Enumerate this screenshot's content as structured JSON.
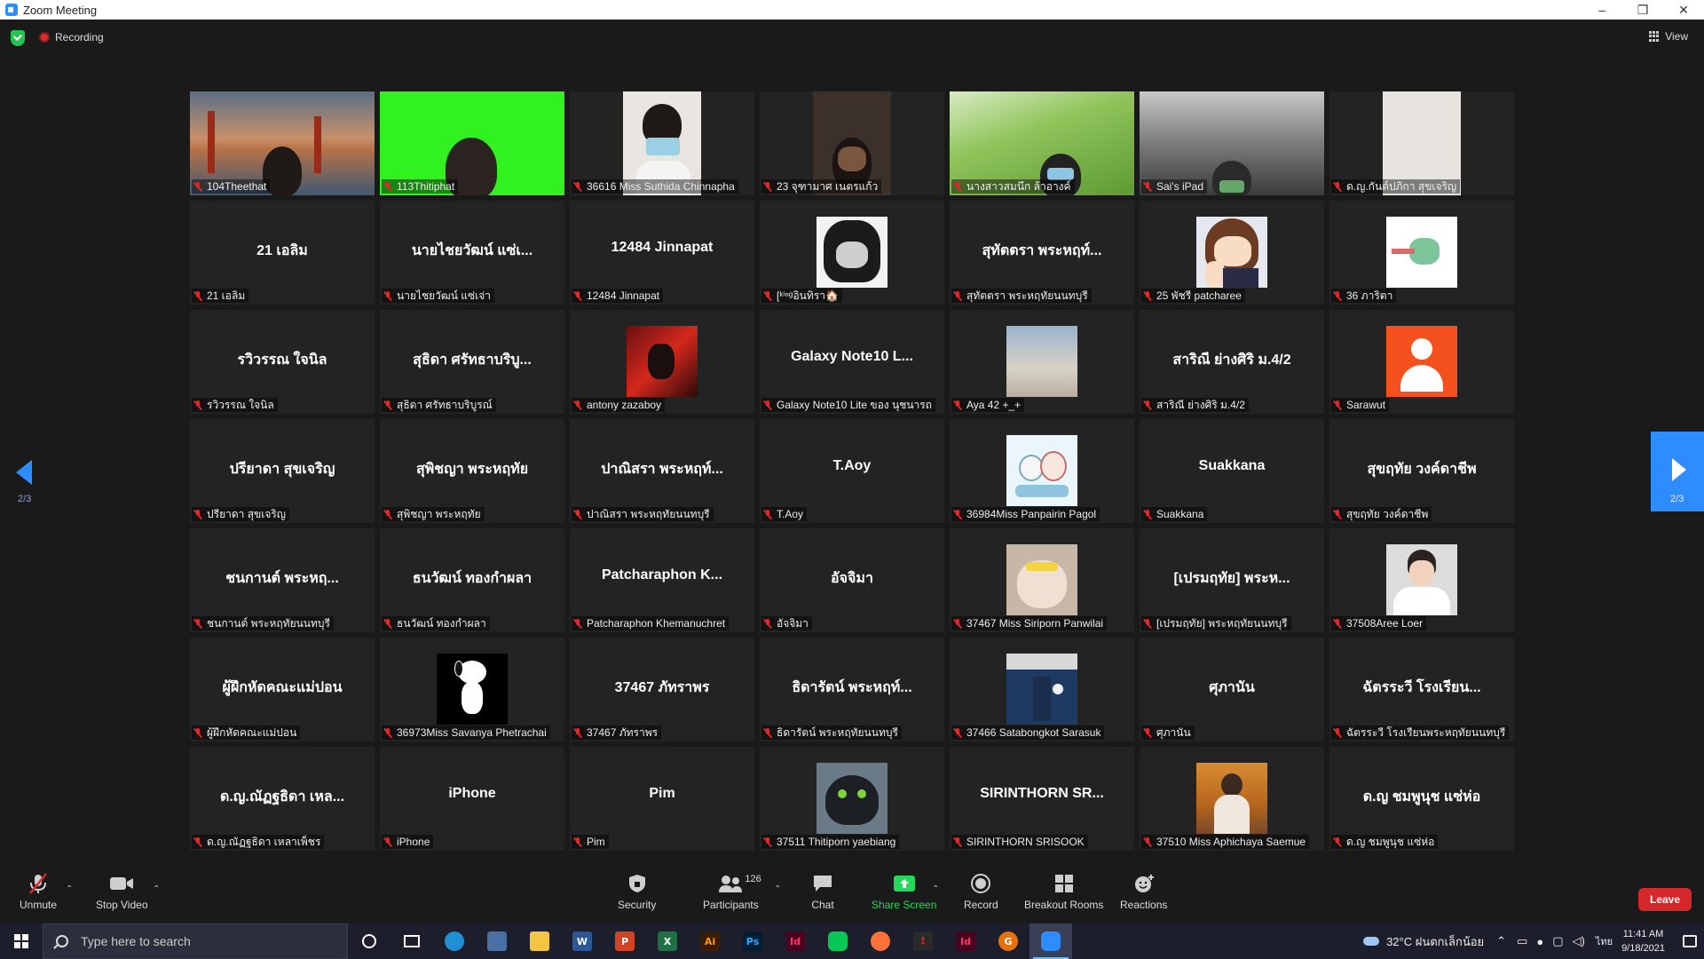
{
  "window": {
    "title": "Zoom Meeting",
    "minimize": "–",
    "maximize": "❐",
    "close": "✕"
  },
  "topbar": {
    "recording_label": "Recording",
    "view_label": "View"
  },
  "gallery": {
    "page_indicator_left": "2/3",
    "page_indicator_right": "2/3",
    "tiles": [
      {
        "caption": "104Theethat",
        "display": "",
        "visual": "bridge"
      },
      {
        "caption": "113Thitiphat",
        "display": "",
        "visual": "green"
      },
      {
        "caption": "36616 Miss Suthida Chinnapha",
        "display": "",
        "visual": "video-white"
      },
      {
        "caption": "23 จุฑามาศ เนตรแก้ว",
        "display": "",
        "visual": "video-dark"
      },
      {
        "caption": "นางสาวสมนึก ล้าอางค์",
        "display": "",
        "visual": "grass"
      },
      {
        "caption": "Sai's iPad",
        "display": "",
        "visual": "roof"
      },
      {
        "caption": "ด.ญ.กันต์ปภิกา สุขเจริญ",
        "display": "",
        "visual": "wall"
      },
      {
        "caption": "21 เอลิม",
        "display": "21 เอลิม",
        "visual": "name"
      },
      {
        "caption": "นายไชยวัฒน์ แซ่เจ่า",
        "display": "นายไชยวัฒน์ แซ่เ...",
        "visual": "name"
      },
      {
        "caption": "12484 Jinnapat",
        "display": "12484 Jinnapat",
        "visual": "name"
      },
      {
        "caption": "[ᵏⁱⁿᵍอินทิรา🏠",
        "display": "",
        "visual": "avatar-anime-dark"
      },
      {
        "caption": "สุทัตตรา พระหฤทัยนนทบุรี",
        "display": "สุทัตตรา พระหฤท์...",
        "visual": "name"
      },
      {
        "caption": "25 พัชรี patcharee",
        "display": "",
        "visual": "avatar-anime"
      },
      {
        "caption": "36 ภาริตา",
        "display": "",
        "visual": "avatar-dino"
      },
      {
        "caption": "รวิวรรณ ใจนิล",
        "display": "รวิวรรณ ใจนิล",
        "visual": "name"
      },
      {
        "caption": "สุธิดา ศรัทธาบริบูรณ์",
        "display": "สุธิดา ศรัทธาบริบู...",
        "visual": "name"
      },
      {
        "caption": "antony zazaboy",
        "display": "",
        "visual": "avatar-red"
      },
      {
        "caption": "Galaxy Note10 Lite ของ นุชนารถ",
        "display": "Galaxy Note10 L...",
        "visual": "name"
      },
      {
        "caption": "Aya 42 +_+",
        "display": "",
        "visual": "avatar-sky"
      },
      {
        "caption": "สาริณี ย่างศิริ ม.4/2",
        "display": "สาริณี ย่างศิริ ม.4/2",
        "visual": "name"
      },
      {
        "caption": "Sarawut",
        "display": "",
        "visual": "avatar-orange"
      },
      {
        "caption": "ปรียาดา สุขเจริญ",
        "display": "ปรียาดา สุขเจริญ",
        "visual": "name"
      },
      {
        "caption": "สุพิชญา พระหฤทัย",
        "display": "สุพิชญา พระหฤทัย",
        "visual": "name"
      },
      {
        "caption": "ปาณิสรา พระหฤทัยนนทบุรี",
        "display": "ปาณิสรา พระหฤท์...",
        "visual": "name"
      },
      {
        "caption": "T.Aoy",
        "display": "T.Aoy",
        "visual": "name"
      },
      {
        "caption": "36984Miss Panpairin Pagol",
        "display": "",
        "visual": "avatar-cartoon"
      },
      {
        "caption": "Suakkana",
        "display": "Suakkana",
        "visual": "name"
      },
      {
        "caption": "สุขฤทัย วงค์ดาชีพ",
        "display": "สุขฤทัย วงค์ดาชีพ",
        "visual": "name"
      },
      {
        "caption": "ชนกานต์ พระหฤทัยนนทบุรี",
        "display": "ชนกานต์ พระหฤ...",
        "visual": "name"
      },
      {
        "caption": "ธนวัฒน์ ทองกำผลา",
        "display": "ธนวัฒน์ ทองกำผลา",
        "visual": "name"
      },
      {
        "caption": "Patcharaphon Khemanuchret",
        "display": "Patcharaphon K...",
        "visual": "name"
      },
      {
        "caption": "อัจจิมา",
        "display": "อัจจิมา",
        "visual": "name"
      },
      {
        "caption": "37467 Miss Siriporn Panwilai",
        "display": "",
        "visual": "avatar-cat"
      },
      {
        "caption": "[เปรมฤทัย] พระหฤทัยนนทบุรี",
        "display": "[เปรมฤทัย] พระห...",
        "visual": "name"
      },
      {
        "caption": "37508Aree Loer",
        "display": "",
        "visual": "avatar-man"
      },
      {
        "caption": "ผู้ฝึกหัดคณะแม่ปอน",
        "display": "ผู้ฝึกหัดคณะแม่ปอน",
        "visual": "name"
      },
      {
        "caption": "36973Miss Savanya Phetrachai",
        "display": "",
        "visual": "avatar-snoopy"
      },
      {
        "caption": "37467 ภัทราพร",
        "display": "37467 ภัทราพร",
        "visual": "name"
      },
      {
        "caption": "ธิดารัตน์ พระหฤทัยนนทบุรี",
        "display": "ธิดารัตน์ พระหฤท์...",
        "visual": "name"
      },
      {
        "caption": "37466 Satabongkot Sarasuk",
        "display": "",
        "visual": "avatar-shirt"
      },
      {
        "caption": "ศุภานัน",
        "display": "ศุภานัน",
        "visual": "name"
      },
      {
        "caption": "ฉัตรระวี โรงเรียนพระหฤทัยนนทบุรี",
        "display": "ฉัตรระวี โรงเรียน...",
        "visual": "name"
      },
      {
        "caption": "ด.ญ.ณัฏฐธิดา เหลาเพ็ชร",
        "display": "ด.ญ.ณัฏฐธิดา เหล...",
        "visual": "name"
      },
      {
        "caption": "iPhone",
        "display": "iPhone",
        "visual": "name"
      },
      {
        "caption": "Pim",
        "display": "Pim",
        "visual": "name"
      },
      {
        "caption": "37511 Thitiporn yaebiang",
        "display": "",
        "visual": "avatar-dragon"
      },
      {
        "caption": "SIRINTHORN SRISOOK",
        "display": "SIRINTHORN SR...",
        "visual": "name"
      },
      {
        "caption": "37510 Miss Aphichaya Saemue",
        "display": "",
        "visual": "avatar-autumn"
      },
      {
        "caption": "ด.ญ ชมพูนุช แซ่ห่อ",
        "display": "ด.ญ ชมพูนุช แซ่ห่อ",
        "visual": "name"
      }
    ]
  },
  "controls": {
    "unmute": "Unmute",
    "stop_video": "Stop Video",
    "security": "Security",
    "participants": "Participants",
    "participant_count": "126",
    "chat": "Chat",
    "share_screen": "Share Screen",
    "record": "Record",
    "breakout_rooms": "Breakout Rooms",
    "reactions": "Reactions",
    "leave": "Leave",
    "share_color": "#23d959",
    "leave_color": "#d6282b"
  },
  "taskbar": {
    "search_placeholder": "Type here to search",
    "weather": "32°C ฝนตกเล็กน้อย",
    "language": "ไทย",
    "time": "11:41 AM",
    "date": "9/18/2021"
  }
}
